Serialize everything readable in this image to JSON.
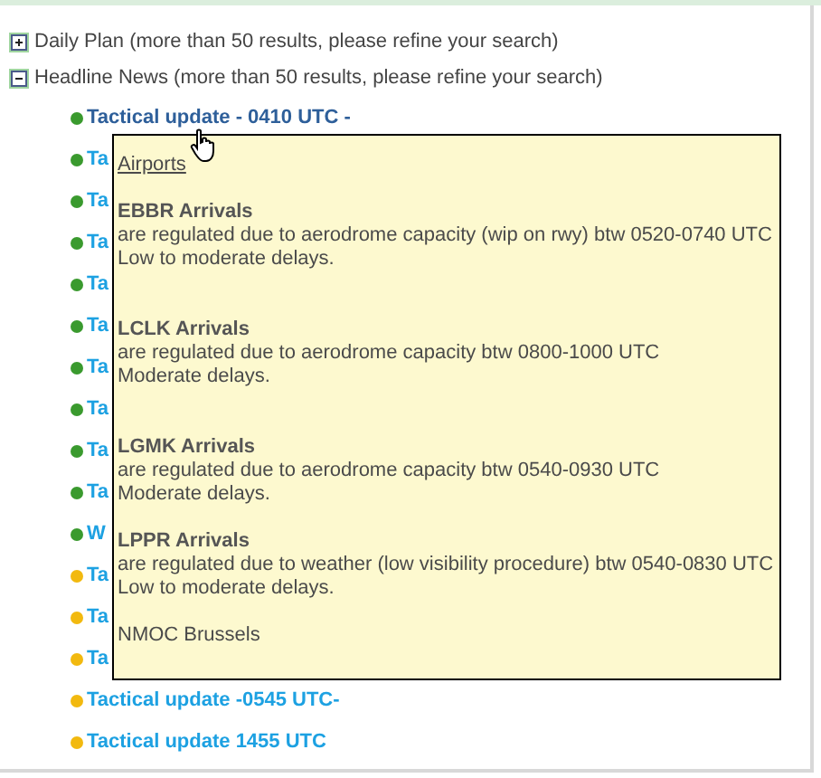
{
  "sections": [
    {
      "label": "Daily Plan (more than 50 results, please refine your search)",
      "expanded": false
    },
    {
      "label": "Headline News (more than 50 results, please refine your search)",
      "expanded": true
    }
  ],
  "news_items": [
    {
      "title": "Tactical update - 0410 UTC -",
      "color": "#3a9a2e",
      "hovered": true
    },
    {
      "title": "Ta",
      "color": "#3a9a2e",
      "hovered": false
    },
    {
      "title": "Ta",
      "color": "#3a9a2e",
      "hovered": false
    },
    {
      "title": "Ta",
      "color": "#3a9a2e",
      "hovered": false
    },
    {
      "title": "Ta",
      "color": "#3a9a2e",
      "hovered": false
    },
    {
      "title": "Ta",
      "color": "#3a9a2e",
      "hovered": false
    },
    {
      "title": "Ta",
      "color": "#3a9a2e",
      "hovered": false
    },
    {
      "title": "Ta",
      "color": "#3a9a2e",
      "hovered": false
    },
    {
      "title": "Ta",
      "color": "#3a9a2e",
      "hovered": false
    },
    {
      "title": "Ta",
      "color": "#3a9a2e",
      "hovered": false
    },
    {
      "title": "W",
      "color": "#3a9a2e",
      "hovered": false
    },
    {
      "title": "Ta",
      "color": "#f2b90f",
      "hovered": false
    },
    {
      "title": "Ta",
      "color": "#f2b90f",
      "hovered": false
    },
    {
      "title": "Ta",
      "color": "#f2b90f",
      "hovered": false
    },
    {
      "title": "Tactical update -0545 UTC-",
      "color": "#f2b90f",
      "hovered": false
    },
    {
      "title": "Tactical update 1455 UTC",
      "color": "#f2b90f",
      "hovered": false
    }
  ],
  "tooltip": {
    "heading": "Airports",
    "entries": [
      {
        "title": "EBBR Arrivals",
        "lines": [
          "are regulated due to aerodrome capacity (wip on rwy) btw 0520-0740 UTC",
          "Low to moderate delays."
        ]
      },
      {
        "title": "LCLK Arrivals",
        "lines": [
          "are regulated due to aerodrome capacity btw 0800-1000 UTC",
          "Moderate delays."
        ]
      },
      {
        "title": "LGMK Arrivals",
        "lines": [
          "are regulated due to aerodrome capacity btw 0540-0930 UTC",
          "Moderate delays."
        ]
      },
      {
        "title": "LPPR Arrivals",
        "lines": [
          "are regulated due to weather (low visibility procedure) btw 0540-0830 UTC",
          "Low to moderate delays."
        ]
      }
    ],
    "footer": "NMOC Brussels"
  }
}
